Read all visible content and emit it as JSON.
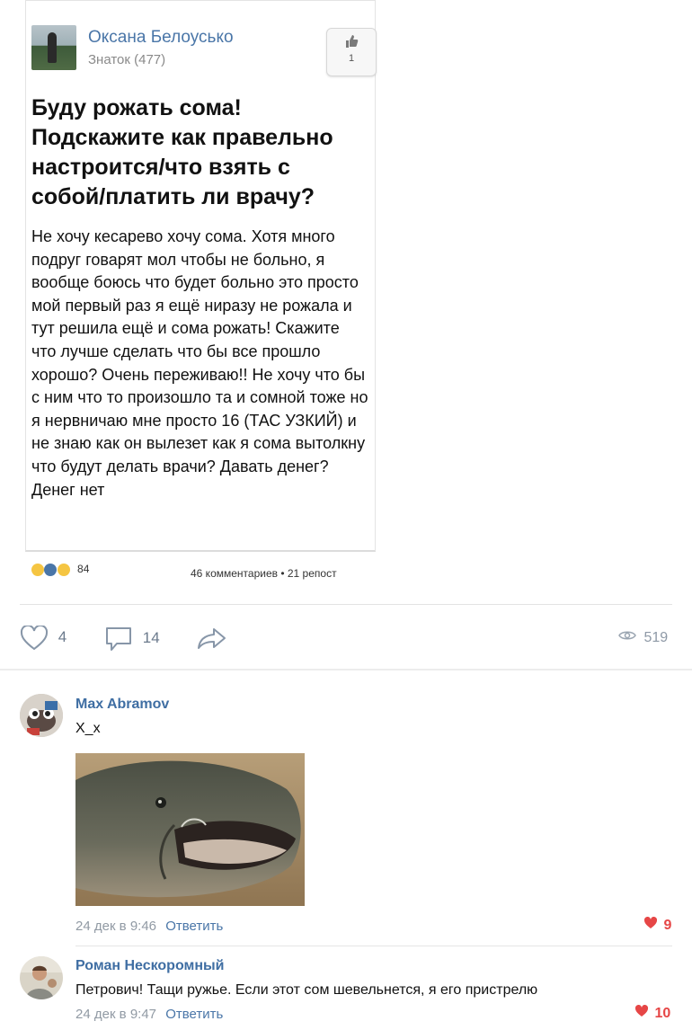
{
  "post": {
    "author": "Оксана Белоусько",
    "rank": "Знаток (477)",
    "like_count": "1",
    "title": "Буду рожать сома! Подскажите как правельно настроится/что взять с собой/платить ли врачу?",
    "body": "Не хочу кесарево хочу сома. Хотя много подруг говарят мол чтобы не больно, я вообще боюсь что будет больно это просто мой первый раз я ещё ниразу не рожала и тут решила ещё и сома рожать! Скажите что лучше сделать что бы все прошло хорошо? Очень переживаю!! Не хочу что бы с ним что то произошло та и сомной тоже но я нервничаю мне просто 16 (ТАС УЗКИЙ) и не знаю как он вылезет как я сома вытолкну что будут делать врачи? Давать денег? Денег нет",
    "reactions_count": "84",
    "comments_reposts": "46 комментариев • 21 репост"
  },
  "actions": {
    "likes": "4",
    "comments": "14",
    "views": "519"
  },
  "comments": [
    {
      "author": "Max Abramov",
      "text": "X_x",
      "time": "24 дек в 9:46",
      "reply": "Ответить",
      "likes": "9"
    },
    {
      "author": "Роман Нескоромный",
      "text": "Петрович! Тащи ружье. Если этот сом шевельнется, я его пристрелю",
      "time": "24 дек в 9:47",
      "reply": "Ответить",
      "likes": "10"
    }
  ],
  "icons": {
    "like": "heart-outline-icon",
    "comment": "speech-bubble-icon",
    "share": "share-arrow-icon",
    "views": "eye-icon",
    "comment_like": "heart-filled-icon",
    "thumb": "thumbs-up-icon"
  },
  "colors": {
    "accent": "#4a76a8",
    "like_red": "#e64646",
    "muted": "#8e99a6"
  }
}
